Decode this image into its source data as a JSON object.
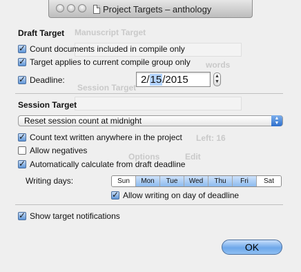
{
  "window": {
    "title": "Project Targets – anthology",
    "ghost_labels": [
      "Manuscript Target",
      "words",
      "Session Target",
      "Left: 16",
      "Options",
      "Edit"
    ]
  },
  "draft": {
    "heading": "Draft Target",
    "opt_compile_only": {
      "label": "Count documents included in compile only",
      "checked": true
    },
    "opt_compile_group": {
      "label": "Target applies to current compile group only",
      "checked": true
    },
    "deadline": {
      "label": "Deadline:",
      "checked": true,
      "month": "2",
      "day": "15",
      "year": "2015",
      "sep": "/"
    }
  },
  "session": {
    "heading": "Session Target",
    "reset_popup": "Reset session count at midnight",
    "opt_anywhere": {
      "label": "Count text written anywhere in the project",
      "checked": true
    },
    "opt_negatives": {
      "label": "Allow negatives",
      "checked": false
    },
    "opt_auto": {
      "label": "Automatically calculate from draft deadline",
      "checked": true
    },
    "writing_days_label": "Writing days:",
    "days": [
      "Sun",
      "Mon",
      "Tue",
      "Wed",
      "Thu",
      "Fri",
      "Sat"
    ],
    "days_selected": [
      false,
      true,
      true,
      true,
      true,
      true,
      false
    ],
    "opt_deadline_day": {
      "label": "Allow writing on day of deadline",
      "checked": true
    }
  },
  "notifications": {
    "label": "Show target notifications",
    "checked": true
  },
  "buttons": {
    "ok": "OK"
  },
  "colors": {
    "accent": "#5f95d6",
    "window_bg": "#efefef"
  }
}
